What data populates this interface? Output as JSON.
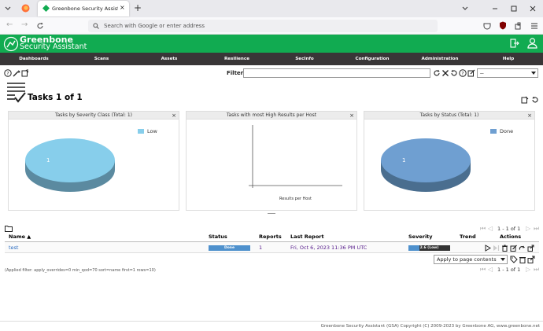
{
  "browser": {
    "tab_title": "Greenbone Security Assistant",
    "new_tab_symbol": "+",
    "url_placeholder": "Search with Google or enter address"
  },
  "brand": {
    "line1": "Greenbone",
    "line2": "Security Assistant"
  },
  "nav": [
    "Dashboards",
    "Scans",
    "Assets",
    "Resilience",
    "SecInfo",
    "Configuration",
    "Administration",
    "Help"
  ],
  "filter": {
    "label": "Filter",
    "value": "",
    "select_value": "--"
  },
  "page": {
    "title": "Tasks 1 of 1"
  },
  "panels": [
    {
      "title": "Tasks by Severity Class (Total: 1)",
      "legend": "Low",
      "slice_label": "1",
      "color": "#87ceeb"
    },
    {
      "title": "Tasks with most High Results per Host",
      "axis_label": "Results per Host"
    },
    {
      "title": "Tasks by Status (Total: 1)",
      "legend": "Done",
      "slice_label": "1",
      "color": "#6f9fd1"
    }
  ],
  "pager": {
    "text": "1 - 1 of 1"
  },
  "table": {
    "headers": {
      "name": "Name ▲",
      "status": "Status",
      "reports": "Reports",
      "last_report": "Last Report",
      "severity": "Severity",
      "trend": "Trend",
      "actions": "Actions"
    },
    "rows": [
      {
        "name": "test",
        "status": "Done",
        "reports": "1",
        "last_report": "Fri, Oct 6, 2023 11:36 PM UTC",
        "severity": "2.6 (Low)",
        "severity_fraction": 0.26
      }
    ]
  },
  "bulk_action": "Apply to page contents",
  "applied_filter": "(Applied filter: apply_overrides=0 min_qod=70 sort=name first=1 rows=10)",
  "footer": "Greenbone Security Assistant (GSA) Copyright (C) 2009-2023 by Greenbone AG, www.greenbone.net",
  "colors": {
    "brand_green": "#11ab51",
    "nav_dark": "#393637",
    "status_blue": "#4f91cd",
    "severity_blue": "#4f91cd",
    "link_purple": "#551a8b"
  }
}
